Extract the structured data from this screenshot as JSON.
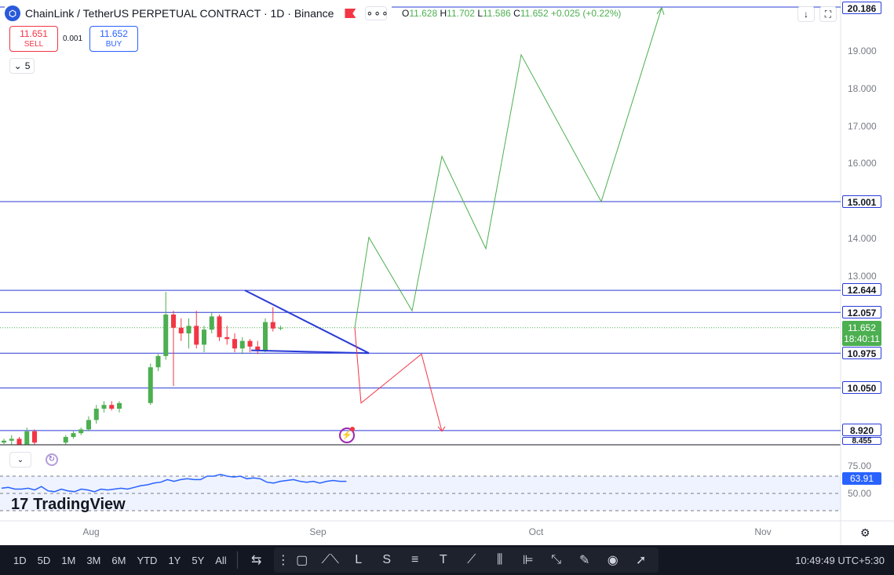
{
  "header": {
    "title": "ChainLink / TetherUS PERPETUAL CONTRACT · 1D · Binance",
    "more_label": "∘∘∘",
    "ohlc": {
      "o_label": "O",
      "o": "11.628",
      "h_label": "H",
      "h": "11.702",
      "l_label": "L",
      "l": "11.586",
      "c_label": "C",
      "c": "11.652",
      "change": "+0.025 (+0.22%)"
    }
  },
  "trade": {
    "sell_price": "11.651",
    "sell_label": "SELL",
    "spread": "0.001",
    "buy_price": "11.652",
    "buy_label": "BUY"
  },
  "indicators_toggle": {
    "count": "5"
  },
  "price_axis": {
    "labels": [
      "19.000",
      "18.000",
      "17.000",
      "16.000",
      "14.000",
      "13.000",
      "75.00",
      "50.00"
    ],
    "tags": {
      "top": "20.186",
      "l15": "15.001",
      "l12644": "12.644",
      "l12057": "12.057",
      "current_price": "11.652",
      "countdown": "18:40:11",
      "l10975": "10.975",
      "l10050": "10.050",
      "l8920": "8.920",
      "l8455": "8.455",
      "rsi": "63.91"
    }
  },
  "time_axis": {
    "labels": [
      "Aug",
      "Sep",
      "Oct",
      "Nov"
    ]
  },
  "brand": {
    "name": "TradingView"
  },
  "toolbar": {
    "timeframes": [
      "1D",
      "5D",
      "1M",
      "3M",
      "6M",
      "YTD",
      "1Y",
      "5Y",
      "All"
    ],
    "clock": "10:49:49 UTC+5:30"
  },
  "icons": {
    "symbol": "chainlink-logo-icon",
    "flag": "red-flag-icon",
    "download": "arrow-down-icon",
    "fullscreen": "fullscreen-icon",
    "settings": "gear-icon",
    "alert": "alert-icon"
  },
  "colors": {
    "up": "#4caf50",
    "down": "#f23645",
    "line": "#2a3bd6",
    "rsi": "#2962ff",
    "bg": "#ffffff",
    "toolbar": "#131722"
  },
  "chart_data": {
    "type": "line",
    "price_range": [
      8.455,
      20.186
    ],
    "horizontal_levels": [
      20.186,
      15.001,
      12.644,
      12.057,
      10.975,
      10.05,
      8.92
    ],
    "current_price": 11.652,
    "candles": [
      {
        "o": 8.6,
        "h": 8.7,
        "l": 8.5,
        "c": 8.65
      },
      {
        "o": 8.65,
        "h": 8.8,
        "l": 8.55,
        "c": 8.7
      },
      {
        "o": 8.7,
        "h": 8.75,
        "l": 8.5,
        "c": 8.55
      },
      {
        "o": 8.55,
        "h": 9.0,
        "l": 8.5,
        "c": 8.9
      },
      {
        "o": 8.9,
        "h": 8.95,
        "l": 8.55,
        "c": 8.6
      },
      {
        "o": 8.6,
        "h": 8.8,
        "l": 8.55,
        "c": 8.75
      },
      {
        "o": 8.75,
        "h": 8.9,
        "l": 8.7,
        "c": 8.85
      },
      {
        "o": 8.85,
        "h": 9.0,
        "l": 8.8,
        "c": 8.95
      },
      {
        "o": 8.95,
        "h": 9.3,
        "l": 8.9,
        "c": 9.2
      },
      {
        "o": 9.2,
        "h": 9.6,
        "l": 9.1,
        "c": 9.5
      },
      {
        "o": 9.5,
        "h": 9.7,
        "l": 9.4,
        "c": 9.6
      },
      {
        "o": 9.6,
        "h": 9.7,
        "l": 9.45,
        "c": 9.5
      },
      {
        "o": 9.5,
        "h": 9.7,
        "l": 9.4,
        "c": 9.65
      },
      {
        "o": 9.65,
        "h": 10.7,
        "l": 9.6,
        "c": 10.6
      },
      {
        "o": 10.6,
        "h": 10.95,
        "l": 10.5,
        "c": 10.9
      },
      {
        "o": 10.9,
        "h": 12.6,
        "l": 10.8,
        "c": 12.0
      },
      {
        "o": 12.0,
        "h": 12.1,
        "l": 10.1,
        "c": 11.65
      },
      {
        "o": 11.65,
        "h": 11.9,
        "l": 11.3,
        "c": 11.5
      },
      {
        "o": 11.5,
        "h": 11.9,
        "l": 11.1,
        "c": 11.7
      },
      {
        "o": 11.7,
        "h": 12.1,
        "l": 11.1,
        "c": 11.2
      },
      {
        "o": 11.2,
        "h": 11.7,
        "l": 11.0,
        "c": 11.6
      },
      {
        "o": 11.6,
        "h": 12.05,
        "l": 11.5,
        "c": 11.95
      },
      {
        "o": 11.95,
        "h": 12.0,
        "l": 11.3,
        "c": 11.4
      },
      {
        "o": 11.4,
        "h": 11.7,
        "l": 11.2,
        "c": 11.35
      },
      {
        "o": 11.35,
        "h": 11.5,
        "l": 11.0,
        "c": 11.1
      },
      {
        "o": 11.1,
        "h": 11.4,
        "l": 10.95,
        "c": 11.3
      },
      {
        "o": 11.3,
        "h": 11.35,
        "l": 11.0,
        "c": 11.15
      },
      {
        "o": 11.15,
        "h": 11.3,
        "l": 10.95,
        "c": 11.05
      },
      {
        "o": 11.05,
        "h": 11.9,
        "l": 11.0,
        "c": 11.8
      },
      {
        "o": 11.8,
        "h": 12.2,
        "l": 11.55,
        "c": 11.63
      },
      {
        "o": 11.628,
        "h": 11.702,
        "l": 11.586,
        "c": 11.652
      }
    ],
    "projection_up": [
      [
        0,
        11.65
      ],
      [
        1,
        14.05
      ],
      [
        2,
        12.1
      ],
      [
        3,
        16.2
      ],
      [
        4,
        13.75
      ],
      [
        5,
        18.9
      ],
      [
        6,
        15.0
      ],
      [
        7,
        20.15
      ]
    ],
    "projection_down": [
      [
        0,
        11.65
      ],
      [
        1,
        9.65
      ],
      [
        2,
        10.95
      ],
      [
        3,
        8.9
      ]
    ],
    "rsi": [
      56,
      57,
      55,
      55,
      56,
      54,
      58,
      53,
      52,
      55,
      53,
      52,
      55,
      54,
      52,
      55,
      54,
      55,
      56,
      55,
      57,
      59,
      60,
      62,
      63,
      66,
      64,
      66,
      67,
      66,
      66,
      70,
      70,
      72,
      70,
      69,
      70,
      67,
      68,
      67,
      63,
      62,
      64,
      65,
      66,
      64,
      63,
      64,
      62,
      64,
      65,
      64,
      64
    ]
  }
}
